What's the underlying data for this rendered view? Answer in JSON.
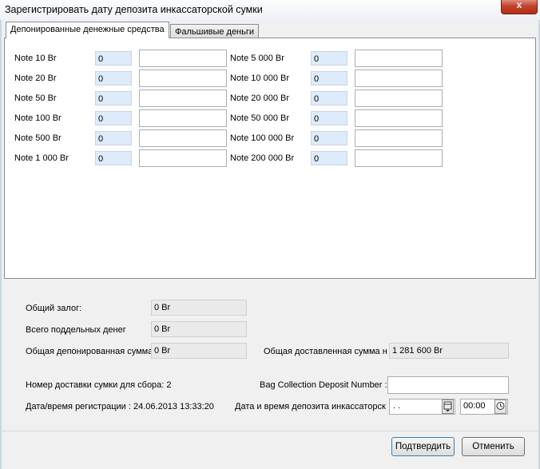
{
  "window": {
    "title": "Зарегистрировать дату депозита инкассаторской сумки",
    "close_glyph": "x"
  },
  "tabs": [
    {
      "label": "Депонированные денежные средства",
      "active": true
    },
    {
      "label": "Фальшивые деньги",
      "active": false
    }
  ],
  "notes_left": [
    {
      "label": "Note 10 Br",
      "count": "0"
    },
    {
      "label": "Note 20 Br",
      "count": "0"
    },
    {
      "label": "Note 50 Br",
      "count": "0"
    },
    {
      "label": "Note 100 Br",
      "count": "0"
    },
    {
      "label": "Note 500 Br",
      "count": "0"
    },
    {
      "label": "Note 1 000 Br",
      "count": "0"
    }
  ],
  "notes_right": [
    {
      "label": "Note 5 000 Br",
      "count": "0"
    },
    {
      "label": "Note 10 000 Br",
      "count": "0"
    },
    {
      "label": "Note 20 000 Br",
      "count": "0"
    },
    {
      "label": "Note 50 000 Br",
      "count": "0"
    },
    {
      "label": "Note 100 000 Br",
      "count": "0"
    },
    {
      "label": "Note 200 000 Br",
      "count": "0"
    }
  ],
  "summary": {
    "total_deposit_label": "Общий залог:",
    "total_deposit_value": "0 Br",
    "total_counterfeit_label": "Всего поддельных денег",
    "total_counterfeit_value": "0 Br",
    "total_deposited_label": "Общая депонированная сумма",
    "total_deposited_value": "0 Br",
    "total_delivered_label": "Общая доставленная сумма на",
    "total_delivered_value": "1 281 600 Br"
  },
  "details": {
    "delivery_number_text": "Номер доставки сумки для сбора: 2",
    "bag_collection_label": "Bag Collection Deposit Number :",
    "bag_collection_value": "",
    "registration_text": "Дата/время регистрации : 24.06.2013 13:33:20",
    "deposit_datetime_label": "Дата и время депозита инкассаторск",
    "date_value": " .  .",
    "time_value": "00:00"
  },
  "buttons": {
    "confirm": "Подтвердить",
    "cancel": "Отменить"
  }
}
